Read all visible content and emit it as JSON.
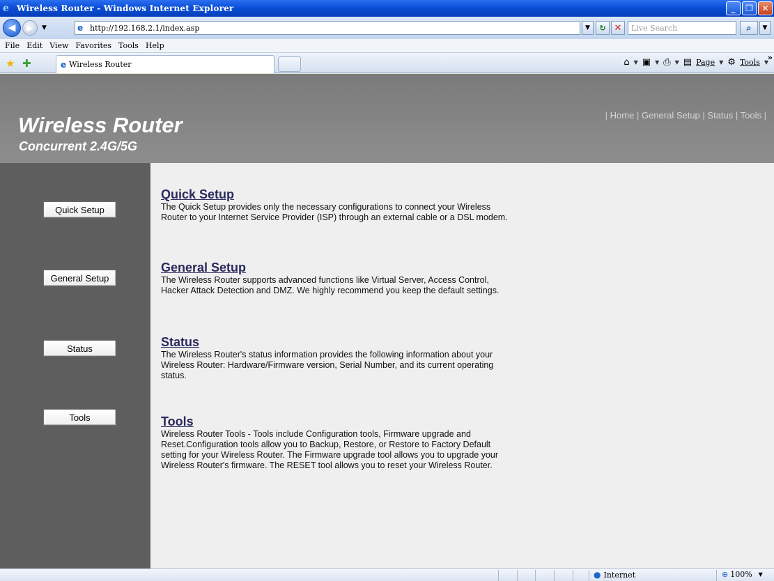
{
  "window": {
    "title": "Wireless Router - Windows Internet Explorer"
  },
  "addressbar": {
    "url": "http://192.168.2.1/index.asp",
    "search_placeholder": "Live Search"
  },
  "menubar": {
    "items": [
      "File",
      "Edit",
      "View",
      "Favorites",
      "Tools",
      "Help"
    ]
  },
  "tabs": [
    {
      "label": "Wireless Router"
    }
  ],
  "commandbar": {
    "page_label": "Page",
    "tools_label": "Tools"
  },
  "header": {
    "title": "Wireless Router",
    "subtitle": "Concurrent 2.4G/5G",
    "nav": [
      "Home",
      "General Setup",
      "Status",
      "Tools"
    ]
  },
  "sidebar": {
    "buttons": [
      "Quick Setup",
      "General Setup",
      "Status",
      "Tools"
    ]
  },
  "sections": [
    {
      "title": "Quick Setup",
      "body": "The Quick Setup provides only the necessary configurations to connect your Wireless Router to your Internet Service Provider (ISP) through an external cable or a DSL modem."
    },
    {
      "title": "General Setup",
      "body": "The Wireless Router supports advanced functions like Virtual Server, Access Control, Hacker Attack Detection and DMZ. We highly recommend you keep the default settings."
    },
    {
      "title": "Status",
      "body": "The Wireless Router's status information provides the following information about your Wireless Router: Hardware/Firmware version, Serial Number, and its current operating status."
    },
    {
      "title": "Tools",
      "body": "Wireless Router Tools - Tools include Configuration tools, Firmware upgrade and Reset.Configuration tools allow you to Backup, Restore, or Restore to Factory Default setting for your Wireless Router. The Firmware upgrade tool allows you to upgrade your Wireless Router's firmware. The RESET tool allows you to reset your Wireless Router."
    }
  ],
  "statusbar": {
    "zone": "Internet",
    "zoom": "100%"
  },
  "colors": {
    "header_bg": "#858585",
    "sidebar_bg": "#5e5e5e",
    "content_bg": "#efefef",
    "link_color": "#2a2a5e"
  }
}
